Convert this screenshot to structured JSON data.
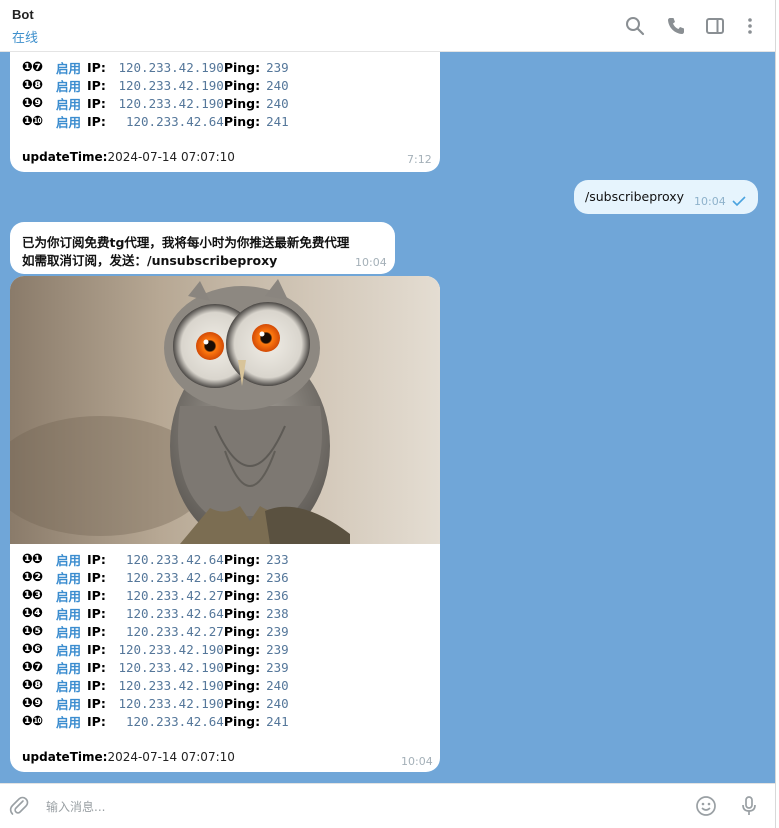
{
  "header": {
    "title": "Bot",
    "status": "在线"
  },
  "proxy_status": {
    "enabled": "启用",
    "ip_label": "IP:",
    "ping_label": "Ping:"
  },
  "top_message": {
    "rows": [
      {
        "num": "❶❼",
        "ip": "120.233.42.190",
        "ping": "239"
      },
      {
        "num": "❶❽",
        "ip": "120.233.42.190",
        "ping": "240"
      },
      {
        "num": "❶❾",
        "ip": "120.233.42.190",
        "ping": "240"
      },
      {
        "num": "❶❿",
        "ip": "120.233.42.64",
        "ping": "241"
      }
    ],
    "update_label": "updateTime:",
    "update_value": "2024-07-14 07:07:10",
    "time": "7:12"
  },
  "outgoing": {
    "text": "/subscribeproxy",
    "time": "10:04"
  },
  "subscribe_reply": {
    "line1": "已为你订阅免费tg代理，我将每小时为你推送最新免费代理",
    "line2": "如需取消订阅，发送：/unsubscribeproxy",
    "time": "10:04"
  },
  "photo_message": {
    "rows": [
      {
        "num": "❶❶",
        "ip": "120.233.42.64",
        "ping": "233"
      },
      {
        "num": "❶❷",
        "ip": "120.233.42.64",
        "ping": "236"
      },
      {
        "num": "❶❸",
        "ip": "120.233.42.27",
        "ping": "236"
      },
      {
        "num": "❶❹",
        "ip": "120.233.42.64",
        "ping": "238"
      },
      {
        "num": "❶❺",
        "ip": "120.233.42.27",
        "ping": "239"
      },
      {
        "num": "❶❻",
        "ip": "120.233.42.190",
        "ping": "239"
      },
      {
        "num": "❶❼",
        "ip": "120.233.42.190",
        "ping": "239"
      },
      {
        "num": "❶❽",
        "ip": "120.233.42.190",
        "ping": "240"
      },
      {
        "num": "❶❾",
        "ip": "120.233.42.190",
        "ping": "240"
      },
      {
        "num": "❶❿",
        "ip": "120.233.42.64",
        "ping": "241"
      }
    ],
    "update_label": "updateTime:",
    "update_value": "2024-07-14 07:07:10",
    "time": "10:04"
  },
  "composer": {
    "placeholder": "输入消息..."
  },
  "icons": {
    "header": [
      "search-icon",
      "phone-icon",
      "sidebar-toggle-icon",
      "more-vertical-icon"
    ],
    "composer": [
      "attach-icon",
      "emoji-icon",
      "microphone-icon"
    ],
    "read_status": "check-icon"
  },
  "colors": {
    "chat_background": "#70a6d8",
    "accent": "#3d8fcc",
    "outgoing_bubble": "#e6f4fd"
  }
}
